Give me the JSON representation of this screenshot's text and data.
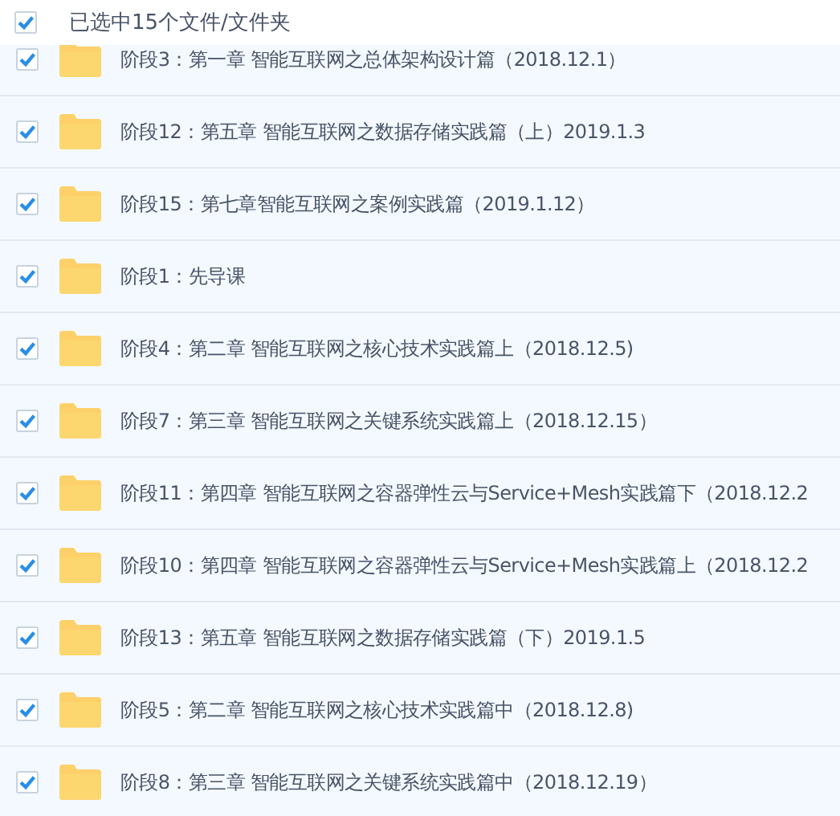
{
  "header": {
    "label": "已选中15个文件/文件夹",
    "checked": true
  },
  "files": [
    {
      "name": "阶段3：第一章 智能互联网之总体架构设计篇（2018.12.1）",
      "checked": true
    },
    {
      "name": "阶段12：第五章 智能互联网之数据存储实践篇（上）2019.1.3",
      "checked": true
    },
    {
      "name": "阶段15：第七章智能互联网之案例实践篇（2019.1.12）",
      "checked": true
    },
    {
      "name": "阶段1：先导课",
      "checked": true
    },
    {
      "name": "阶段4：第二章 智能互联网之核心技术实践篇上（2018.12.5)",
      "checked": true
    },
    {
      "name": "阶段7：第三章 智能互联网之关键系统实践篇上（2018.12.15）",
      "checked": true
    },
    {
      "name": "阶段11：第四章 智能互联网之容器弹性云与Service+Mesh实践篇下（2018.12.2",
      "checked": true
    },
    {
      "name": "阶段10：第四章 智能互联网之容器弹性云与Service+Mesh实践篇上（2018.12.2",
      "checked": true
    },
    {
      "name": "阶段13：第五章 智能互联网之数据存储实践篇（下）2019.1.5",
      "checked": true
    },
    {
      "name": "阶段5：第二章 智能互联网之核心技术实践篇中（2018.12.8)",
      "checked": true
    },
    {
      "name": "阶段8：第三章 智能互联网之关键系统实践篇中（2018.12.19）",
      "checked": true
    }
  ]
}
